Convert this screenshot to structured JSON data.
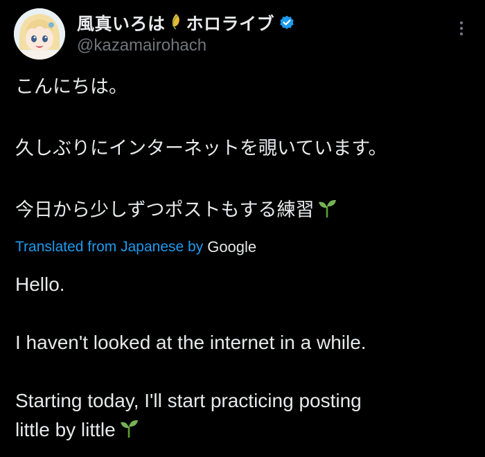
{
  "author": {
    "display_name": "風真いろは",
    "display_name_suffix": "ホロライブ",
    "handle": "@kazamairohach",
    "leaf_icon": "leaf-icon",
    "verified_icon": "verified-badge-icon",
    "verified_color": "#1d9bf0"
  },
  "menu": {
    "icon": "more-options-icon"
  },
  "tweet": {
    "original_lines": [
      "こんにちは。",
      "",
      "久しぶりにインターネットを覗いています。",
      "",
      "今日から少しずつポストもする練習"
    ],
    "translated_label": "Translated from Japanese by",
    "translation_provider": "Google",
    "translated_lines": [
      "Hello.",
      "",
      "I haven't looked at the internet in a while.",
      "",
      "Starting today, I'll start practicing posting",
      "little by little"
    ],
    "emoji_icon": "seedling-icon"
  },
  "colors": {
    "background": "#000000",
    "text": "#e7e9ea",
    "secondary_text": "#71767b",
    "link": "#1d9bf0"
  }
}
